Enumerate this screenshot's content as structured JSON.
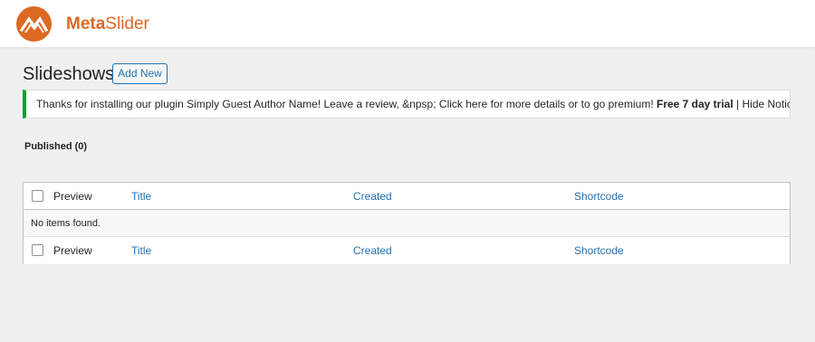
{
  "brand": {
    "name_part1": "Meta",
    "name_part2": "Slider",
    "accent": "#dd6923",
    "logo_icon": "metaslider-logo-icon"
  },
  "page": {
    "title": "Slideshows",
    "add_new_label": "Add New"
  },
  "notice": {
    "text": "Thanks for installing our plugin Simply Guest Author Name! Leave a review, &npsp; Click here for more details or to go premium! ",
    "bold_text": "Free 7 day trial",
    "separator": " | ",
    "hide_label": "Hide Notice",
    "border_color": "#00a32a"
  },
  "filter": {
    "published_label": "Published (0)"
  },
  "table": {
    "columns": [
      "Preview",
      "Title",
      "Created",
      "Shortcode"
    ],
    "empty_message": "No items found.",
    "link_color": "#2271b1"
  }
}
